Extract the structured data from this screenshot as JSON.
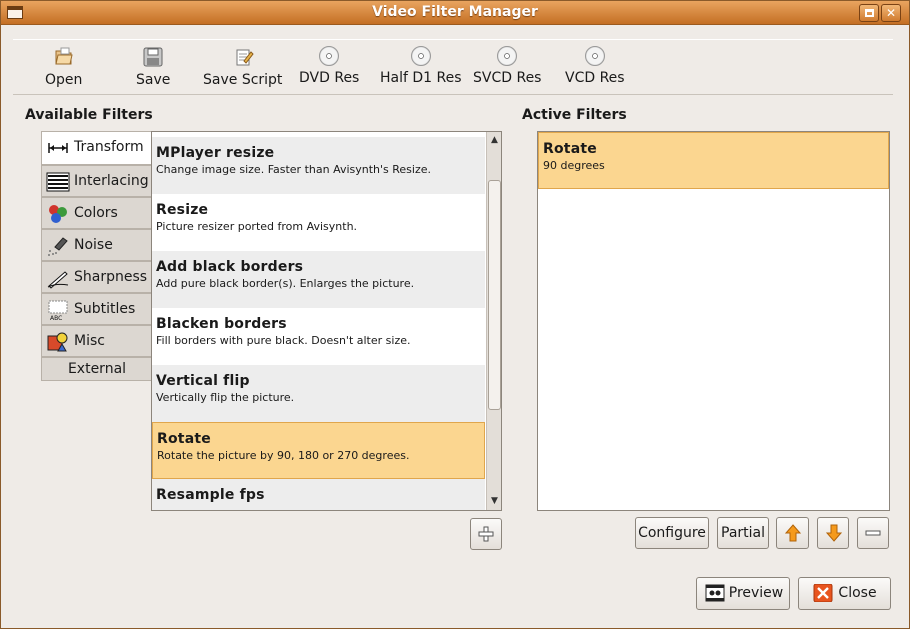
{
  "window": {
    "title": "Video Filter Manager"
  },
  "toolbar": {
    "items": [
      {
        "label": "Open",
        "icon": "folder-open-icon"
      },
      {
        "label": "Save",
        "icon": "floppy-disk-icon"
      },
      {
        "label": "Save Script",
        "icon": "script-icon"
      },
      {
        "label": "DVD Res",
        "icon": "disc-icon"
      },
      {
        "label": "Half D1 Res",
        "icon": "disc-icon"
      },
      {
        "label": "SVCD Res",
        "icon": "disc-icon"
      },
      {
        "label": "VCD Res",
        "icon": "disc-icon"
      }
    ]
  },
  "available": {
    "title": "Available Filters",
    "categories": [
      {
        "label": "Transform",
        "icon": "transform-icon",
        "active": true
      },
      {
        "label": "Interlacing",
        "icon": "interlacing-icon"
      },
      {
        "label": "Colors",
        "icon": "colors-icon"
      },
      {
        "label": "Noise",
        "icon": "noise-icon"
      },
      {
        "label": "Sharpness",
        "icon": "sharpness-icon"
      },
      {
        "label": "Subtitles",
        "icon": "subtitles-icon"
      },
      {
        "label": "Misc",
        "icon": "misc-icon"
      },
      {
        "label": "External",
        "icon": ""
      }
    ],
    "filters": [
      {
        "name": "MPlayer resize",
        "desc": "Change image size. Faster than Avisynth's Resize."
      },
      {
        "name": "Resize",
        "desc": "Picture resizer ported from Avisynth."
      },
      {
        "name": "Add black borders",
        "desc": "Add pure black border(s). Enlarges the picture."
      },
      {
        "name": "Blacken borders",
        "desc": "Fill borders with pure black. Doesn't alter size."
      },
      {
        "name": "Vertical flip",
        "desc": "Vertically flip the picture."
      },
      {
        "name": "Rotate",
        "desc": "Rotate the picture by 90, 180 or 270 degrees.",
        "selected": true
      },
      {
        "name": "Resample fps",
        "desc": ""
      }
    ],
    "add_button_icon": "plus-icon"
  },
  "active": {
    "title": "Active Filters",
    "filters": [
      {
        "name": "Rotate",
        "desc": "90 degrees"
      }
    ]
  },
  "buttons": {
    "configure": "Configure",
    "partial": "Partial",
    "up_icon": "arrow-up-icon",
    "down_icon": "arrow-down-icon",
    "remove_icon": "minus-icon",
    "preview": "Preview",
    "close": "Close"
  },
  "colors": {
    "titlebar": "#d98a3f",
    "selection": "#fbd690",
    "selection_border": "#e0a64c",
    "arrow_orange": "#f59a1c",
    "close_red": "#e8541e"
  }
}
